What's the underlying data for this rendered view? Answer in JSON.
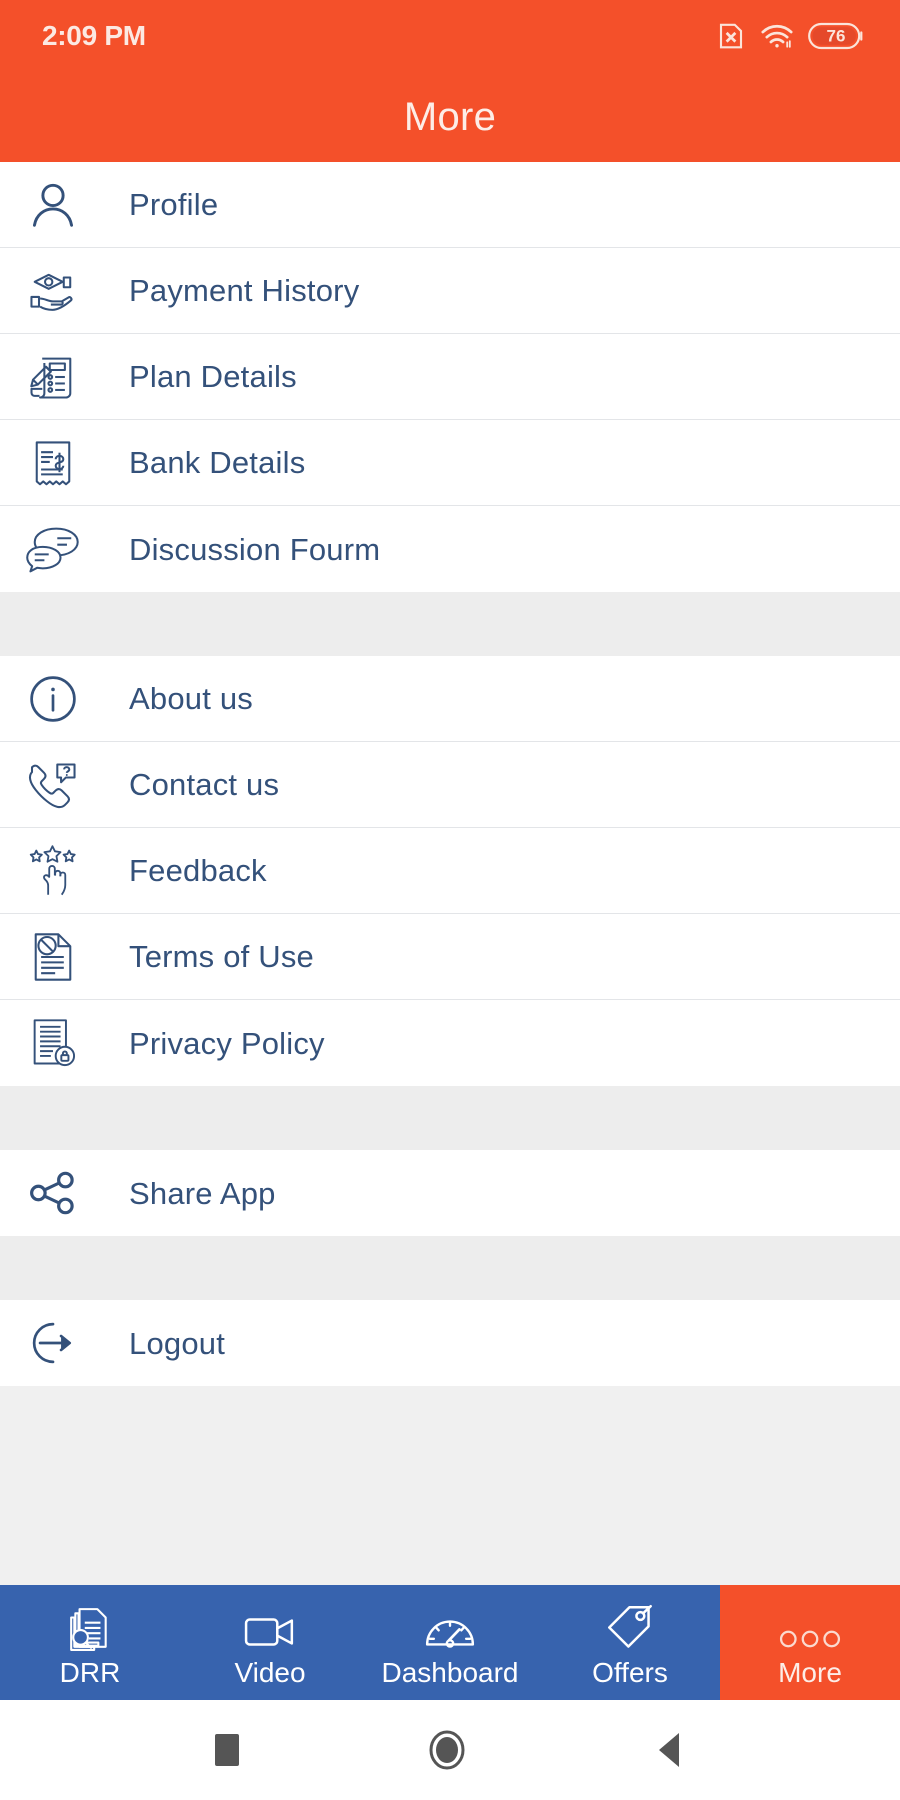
{
  "status_bar": {
    "time": "2:09 PM",
    "sim_icon": "sim-card-x-icon",
    "wifi_icon": "wifi-icon",
    "battery_icon": "battery-icon",
    "battery_level": "76"
  },
  "header": {
    "title": "More"
  },
  "colors": {
    "accent_orange": "#F4502A",
    "nav_blue": "#3763AE",
    "text_blue": "#34517A",
    "divider": "#e3e5e8",
    "group_gap": "#ededed"
  },
  "menu": {
    "groups": [
      {
        "name": "account-group",
        "items": [
          {
            "label": "Profile",
            "icon": "person-icon"
          },
          {
            "label": "Payment History",
            "icon": "money-hand-icon"
          },
          {
            "label": "Plan Details",
            "icon": "clipboard-pencil-icon"
          },
          {
            "label": "Bank Details",
            "icon": "receipt-dollar-icon"
          },
          {
            "label": "Discussion Fourm",
            "icon": "chat-bubbles-icon"
          }
        ]
      },
      {
        "name": "info-group",
        "items": [
          {
            "label": "About us",
            "icon": "info-circle-icon"
          },
          {
            "label": "Contact us",
            "icon": "phone-question-icon"
          },
          {
            "label": "Feedback",
            "icon": "stars-hand-icon"
          },
          {
            "label": "Terms of Use",
            "icon": "document-blocked-icon"
          },
          {
            "label": "Privacy Policy",
            "icon": "document-lock-icon"
          }
        ]
      },
      {
        "name": "share-group",
        "items": [
          {
            "label": "Share App",
            "icon": "share-nodes-icon"
          }
        ]
      },
      {
        "name": "session-group",
        "items": [
          {
            "label": "Logout",
            "icon": "logout-arrow-icon"
          }
        ]
      }
    ]
  },
  "tabbar": {
    "tabs": [
      {
        "label": "DRR",
        "icon": "documents-search-icon",
        "active": false
      },
      {
        "label": "Video",
        "icon": "video-camera-icon",
        "active": false
      },
      {
        "label": "Dashboard",
        "icon": "speedometer-icon",
        "active": false
      },
      {
        "label": "Offers",
        "icon": "price-tag-icon",
        "active": false
      },
      {
        "label": "More",
        "icon": "three-dots-icon",
        "active": true
      }
    ]
  },
  "system_nav": {
    "recents": "square-recents-icon",
    "home": "circle-home-icon",
    "back": "triangle-back-icon"
  }
}
